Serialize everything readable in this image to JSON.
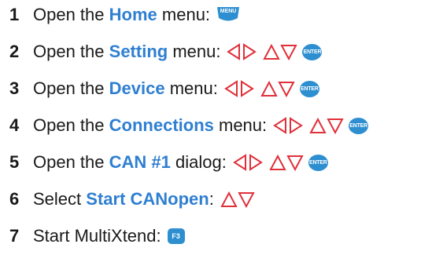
{
  "steps": [
    {
      "num": "1",
      "pre": "Open the",
      "kw": "Home",
      "post": "menu:",
      "keys": {
        "menu": "MENU"
      }
    },
    {
      "num": "2",
      "pre": "Open the",
      "kw": "Setting",
      "post": "menu:",
      "keys": {
        "enter": "ENTER"
      }
    },
    {
      "num": "3",
      "pre": "Open the",
      "kw": "Device",
      "post": "menu:",
      "keys": {
        "enter": "ENTER"
      }
    },
    {
      "num": "4",
      "pre": "Open the",
      "kw": "Connections",
      "post": "menu:",
      "keys": {
        "enter": "ENTER"
      }
    },
    {
      "num": "5",
      "pre": "Open the",
      "kw": "CAN #1",
      "post": "dialog:",
      "keys": {
        "enter": "ENTER"
      }
    },
    {
      "num": "6",
      "pre": "Select",
      "kw": "Start CANopen",
      "post": ":",
      "keys": {}
    },
    {
      "num": "7",
      "pre": "Start MultiXtend:",
      "kw": "",
      "post": "",
      "keys": {
        "f3": "F3"
      }
    }
  ],
  "icons": {
    "left_right_arrows": "left-right-arrows-icon",
    "up_down_arrows": "up-down-arrows-icon"
  },
  "colors": {
    "keyword": "#2f7fd1",
    "button": "#2e8fd0",
    "arrow_stroke": "#e0303a",
    "updown_stroke": "#e0303a"
  }
}
